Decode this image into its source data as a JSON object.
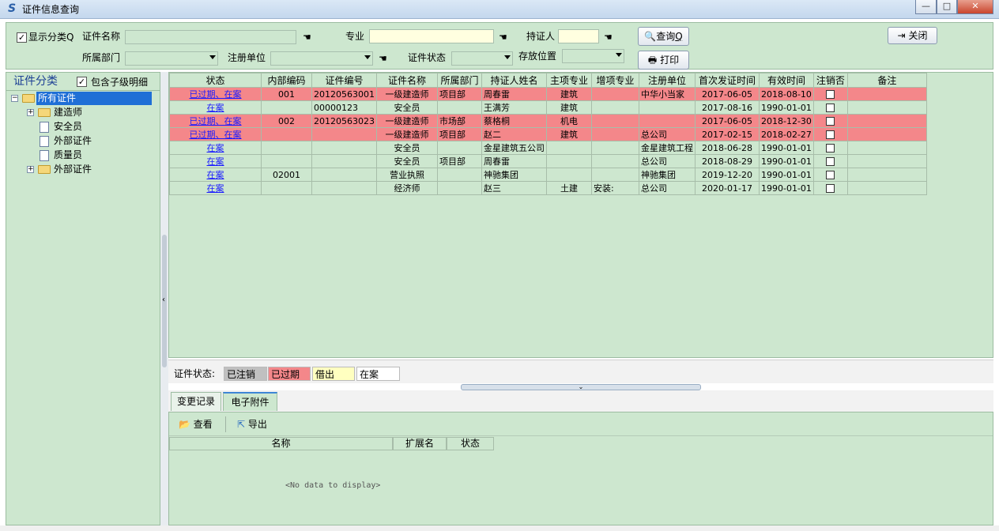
{
  "window": {
    "title": "证件信息查询",
    "minimize": "—",
    "maximize": "□",
    "close": "✕"
  },
  "filters": {
    "show_category_label": "显示分类Q",
    "show_category_checked": true,
    "cert_name_label": "证件名称",
    "cert_name_value": "",
    "major_label": "专业",
    "major_value": "",
    "holder_label": "持证人",
    "holder_value": "",
    "dept_label": "所属部门",
    "dept_value": "",
    "reg_unit_label": "注册单位",
    "reg_unit_value": "",
    "cert_status_label": "证件状态",
    "cert_status_value": "",
    "storage_label": "存放位置",
    "storage_value": "",
    "query_button": "查询",
    "query_shortcut": "Q",
    "print_button": "打印",
    "close_button": "关闭"
  },
  "sidebar": {
    "title": "证件分类",
    "include_sub_label": "包含子级明细",
    "include_sub_checked": true,
    "tree": [
      {
        "label": "所有证件",
        "selected": true,
        "expander": "−",
        "type": "folder",
        "depth": 0
      },
      {
        "label": "建造师",
        "expander": "+",
        "type": "folder",
        "depth": 1
      },
      {
        "label": "安全员",
        "type": "doc",
        "depth": 1
      },
      {
        "label": "外部证件",
        "type": "doc",
        "depth": 1
      },
      {
        "label": "质量员",
        "type": "doc",
        "depth": 1
      },
      {
        "label": "外部证件",
        "expander": "+",
        "type": "folder",
        "depth": 1
      }
    ]
  },
  "grid": {
    "columns": [
      "状态",
      "内部编码",
      "证件编号",
      "证件名称",
      "所属部门",
      "持证人姓名",
      "主项专业",
      "增项专业",
      "注册单位",
      "首次发证时间",
      "有效时间",
      "注销否",
      "备注"
    ],
    "rows": [
      {
        "style": "red",
        "cells": [
          "已过期、在案",
          "001",
          "20120563001",
          "一级建造师",
          "项目部",
          "周春雷",
          "建筑",
          "",
          "中华小当家",
          "2017-06-05",
          "2018-08-10",
          "",
          ""
        ]
      },
      {
        "style": "green",
        "cells": [
          "在案",
          "",
          "00000123",
          "安全员",
          "",
          "王满芳",
          "建筑",
          "",
          "",
          "2017-08-16",
          "1990-01-01",
          "",
          ""
        ]
      },
      {
        "style": "red",
        "cells": [
          "已过期、在案",
          "002",
          "20120563023",
          "一级建造师",
          "市场部",
          "蔡格桐",
          "机电",
          "",
          "",
          "2017-06-05",
          "2018-12-30",
          "",
          ""
        ]
      },
      {
        "style": "red",
        "cells": [
          "已过期、在案",
          "",
          "",
          "一级建造师",
          "项目部",
          "赵二",
          "建筑",
          "",
          "总公司",
          "2017-02-15",
          "2018-02-27",
          "",
          ""
        ]
      },
      {
        "style": "green",
        "cells": [
          "在案",
          "",
          "",
          "安全员",
          "",
          "金星建筑五公司",
          "",
          "",
          "金星建筑工程",
          "2018-06-28",
          "1990-01-01",
          "",
          ""
        ]
      },
      {
        "style": "green",
        "cells": [
          "在案",
          "",
          "",
          "安全员",
          "项目部",
          "周春雷",
          "",
          "",
          "总公司",
          "2018-08-29",
          "1990-01-01",
          "",
          ""
        ]
      },
      {
        "style": "green",
        "cells": [
          "在案",
          "02001",
          "",
          "营业执照",
          "",
          "神驰集团",
          "",
          "",
          "神驰集团",
          "2019-12-20",
          "1990-01-01",
          "",
          ""
        ]
      },
      {
        "style": "green",
        "cells": [
          "在案",
          "",
          "",
          "经济师",
          "",
          "赵三",
          "土建",
          "安装:",
          "总公司",
          "2020-01-17",
          "1990-01-01",
          "",
          ""
        ]
      }
    ]
  },
  "legend": {
    "label": "证件状态:",
    "items": [
      {
        "text": "已注销",
        "color": "#c0c0c0"
      },
      {
        "text": "已过期",
        "color": "#f4878a"
      },
      {
        "text": "借出",
        "color": "#ffffc0"
      },
      {
        "text": "在案",
        "color": "#ffffff"
      }
    ]
  },
  "bottom": {
    "tabs": [
      "变更记录",
      "电子附件"
    ],
    "active_tab": 1,
    "view_button": "查看",
    "export_button": "导出",
    "columns": [
      "名称",
      "扩展名",
      "状态"
    ],
    "empty_text": "<No data to display>"
  },
  "colors": {
    "panel_green": "#cde7cf",
    "expired_red": "#f4878a",
    "link_blue": "#1a1aff"
  }
}
